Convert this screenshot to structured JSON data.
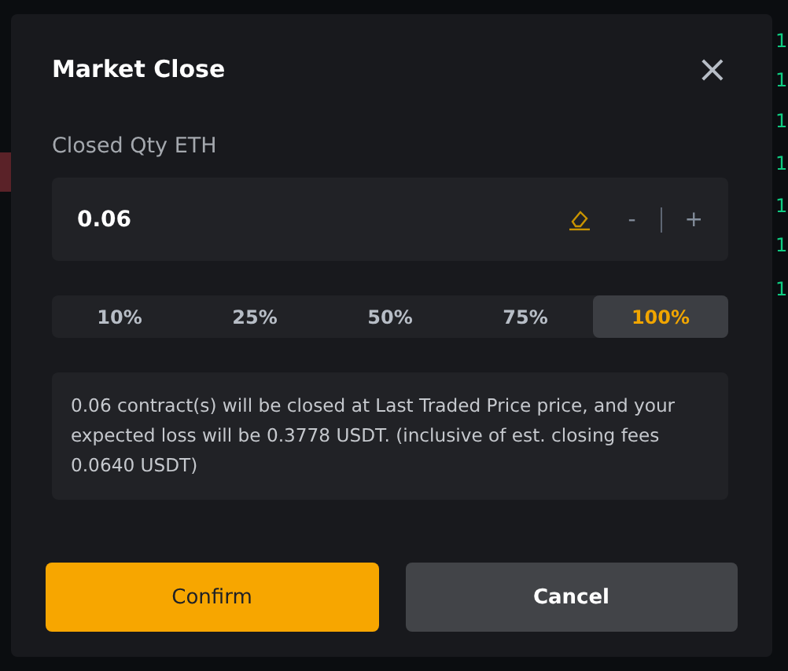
{
  "backdrop": {
    "axis_labels": [
      "1",
      "1",
      "1",
      "1",
      "1",
      "1",
      "1"
    ]
  },
  "dialog": {
    "title": "Market Close",
    "close_icon": "×",
    "quantity": {
      "label": "Closed Qty ETH",
      "value": "0.06",
      "minus": "-",
      "plus": "+"
    },
    "percent_options": [
      {
        "label": "10%",
        "selected": false
      },
      {
        "label": "25%",
        "selected": false
      },
      {
        "label": "50%",
        "selected": false
      },
      {
        "label": "75%",
        "selected": false
      },
      {
        "label": "100%",
        "selected": true
      }
    ],
    "notice": "0.06 contract(s) will be closed at Last Traded Price price, and your expected loss will be 0.3778 USDT. (inclusive of est. closing fees 0.0640 USDT)",
    "buttons": [
      {
        "label": "Confirm",
        "kind": "primary"
      },
      {
        "label": "Cancel",
        "kind": "secondary"
      }
    ]
  }
}
